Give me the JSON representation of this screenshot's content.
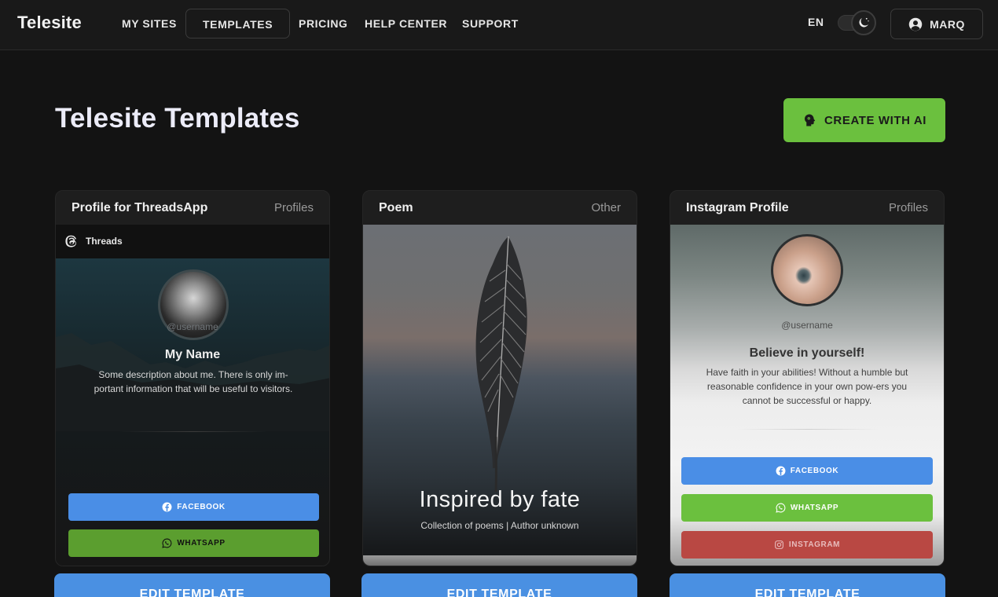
{
  "navbar": {
    "brand": "Telesite",
    "links": [
      "MY SITES",
      "TEMPLATES",
      "PRICING",
      "HELP CENTER",
      "SUPPORT"
    ],
    "active_link": "TEMPLATES",
    "language": "EN",
    "user_label": "MARQ",
    "theme_icon": "moon-icon"
  },
  "header": {
    "title": "Telesite Templates",
    "ai_button": "CREATE WITH AI"
  },
  "cards": [
    {
      "title": "Profile for ThreadsApp",
      "category": "Profiles",
      "preview": {
        "app_label": "Threads",
        "username": "@username",
        "name": "My Name",
        "description": "Some description about me. There is only im-portant information that will be useful to visitors.",
        "buttons": [
          "FACEBOOK",
          "WHATSAPP"
        ]
      }
    },
    {
      "title": "Poem",
      "category": "Other",
      "preview": {
        "headline": "Inspired by fate",
        "subtitle": "Collection of poems | Author unknown"
      }
    },
    {
      "title": "Instagram Profile",
      "category": "Profiles",
      "preview": {
        "username": "@username",
        "name": "Believe in yourself!",
        "description": "Have faith in your abilities! Without a humble but reasonable confidence in your own pow-ers you cannot be successful or happy.",
        "buttons": [
          "FACEBOOK",
          "WHATSAPP",
          "INSTAGRAM"
        ]
      }
    }
  ],
  "edit_label": "EDIT TEMPLATE",
  "colors": {
    "accent_green": "#6bc03e",
    "accent_blue": "#4a90e2",
    "background": "#131313"
  }
}
